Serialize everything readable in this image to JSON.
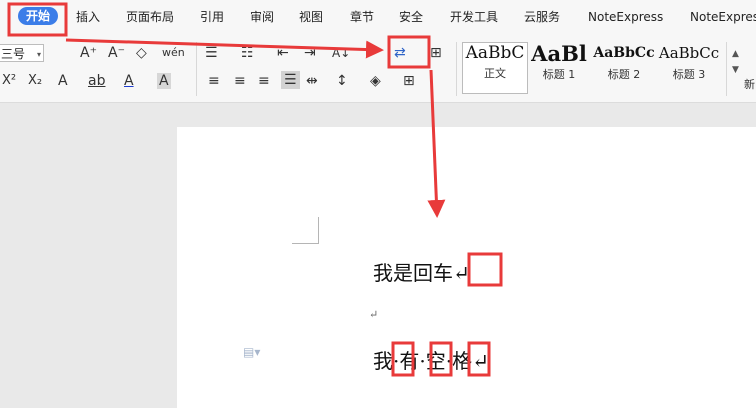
{
  "tabs": [
    {
      "label": "开始",
      "active": true
    },
    {
      "label": "插入"
    },
    {
      "label": "页面布局"
    },
    {
      "label": "引用"
    },
    {
      "label": "审阅"
    },
    {
      "label": "视图"
    },
    {
      "label": "章节"
    },
    {
      "label": "安全"
    },
    {
      "label": "开发工具"
    },
    {
      "label": "云服务"
    },
    {
      "label": "NoteExpress"
    },
    {
      "label": "NoteExpress"
    }
  ],
  "font": {
    "size_value": "三号"
  },
  "icons": {
    "grow_font": "A⁺",
    "shrink_font": "A⁻",
    "clear_format": "◇",
    "pinyin": "wén",
    "superscript": "X²",
    "subscript": "X₂",
    "text_effect": "A",
    "highlight": "ab",
    "font_color": "A",
    "char_shading": "A",
    "bullets": "☰",
    "numbering": "☷",
    "outdent": "⇤",
    "indent": "⇥",
    "sort": "A↓",
    "show_hide": "⇄",
    "table_borders": "⊞",
    "align_left": "≡",
    "align_center": "≡",
    "align_right": "≡",
    "justify": "☰",
    "distributed": "⇹",
    "line_spacing": "↕",
    "shading": "◈",
    "borders": "⊞"
  },
  "styles": [
    {
      "sample": "AaBbC",
      "name": "正文"
    },
    {
      "sample": "AaBl",
      "name": "标题 1"
    },
    {
      "sample": "AaBbCc",
      "name": "标题 2"
    },
    {
      "sample": "AaBbCc",
      "name": "标题 3"
    },
    {
      "sample": "",
      "name": "新"
    }
  ],
  "document": {
    "line1": "我是回车↵",
    "line2": "↵",
    "line3": "我·有·空·格↵"
  },
  "accent_color": "#3b7de8",
  "highlight_color": "#e83a3a"
}
